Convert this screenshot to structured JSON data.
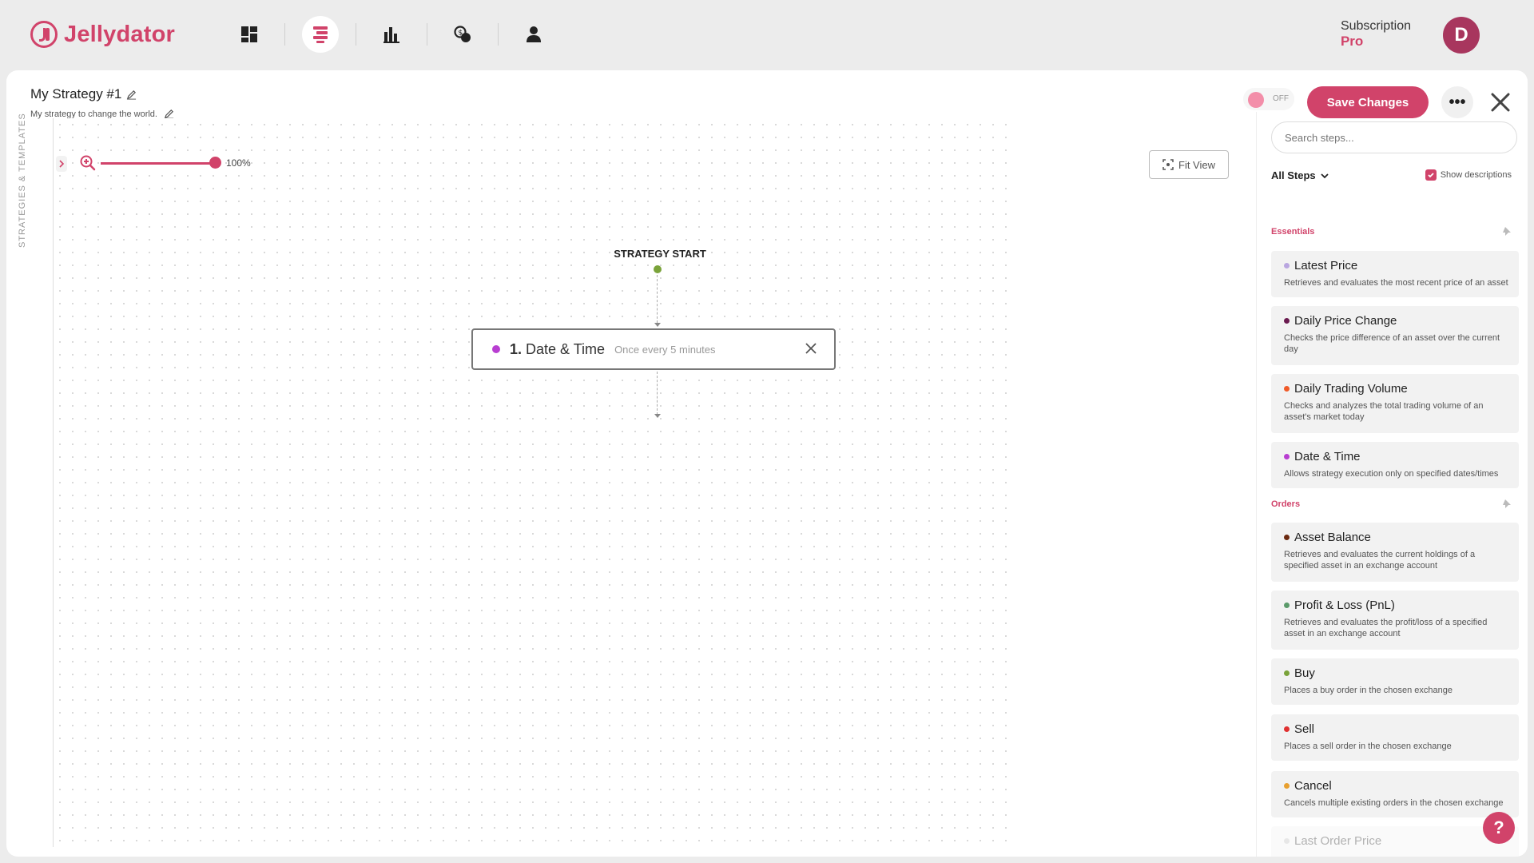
{
  "app": {
    "name": "Jellydator"
  },
  "nav": {
    "items": [
      {
        "name": "dashboard",
        "icon": "dashboard-icon"
      },
      {
        "name": "strategies",
        "icon": "strategy-icon"
      },
      {
        "name": "analytics",
        "icon": "bar-chart-icon"
      },
      {
        "name": "exchanges",
        "icon": "coins-icon"
      },
      {
        "name": "account",
        "icon": "user-icon"
      }
    ],
    "active": "strategies"
  },
  "subscription": {
    "label": "Subscription",
    "plan": "Pro"
  },
  "user": {
    "initial": "D"
  },
  "strategy": {
    "name": "My Strategy #1",
    "description": "My strategy to change the world.",
    "enabled_label": "OFF",
    "save_label": "Save Changes"
  },
  "canvas": {
    "side_tab_label": "STRATEGIES & TEMPLATES",
    "zoom_label": "100%",
    "zoom_percent": 100,
    "fit_view_label": "Fit View",
    "start_label": "STRATEGY START",
    "nodes": [
      {
        "number": "1.",
        "title": "Date & Time",
        "subtitle": "Once every 5 minutes",
        "color": "#b83ed1"
      }
    ]
  },
  "panel": {
    "search_placeholder": "Search steps...",
    "filter_label": "All Steps",
    "show_descriptions_label": "Show descriptions",
    "show_descriptions": true,
    "sections": [
      {
        "label": "Essentials",
        "steps": [
          {
            "title": "Latest Price",
            "description": "Retrieves and evaluates the most recent price of an asset",
            "color": "#b9a6e0"
          },
          {
            "title": "Daily Price Change",
            "description": "Checks the price difference of an asset over the current day",
            "color": "#6a1a4f"
          },
          {
            "title": "Daily Trading Volume",
            "description": "Checks and analyzes the total trading volume of an asset's market today",
            "color": "#f05a28"
          },
          {
            "title": "Date & Time",
            "description": "Allows strategy execution only on specified dates/times",
            "color": "#b83ed1"
          }
        ]
      },
      {
        "label": "Orders",
        "steps": [
          {
            "title": "Asset Balance",
            "description": "Retrieves and evaluates the current holdings of a specified asset in an exchange account",
            "color": "#6b2a10"
          },
          {
            "title": "Profit & Loss (PnL)",
            "description": "Retrieves and evaluates the profit/loss of a specified asset in an exchange account",
            "color": "#5b9a6a"
          },
          {
            "title": "Buy",
            "description": "Places a buy order in the chosen exchange",
            "color": "#7aa33a"
          },
          {
            "title": "Sell",
            "description": "Places a sell order in the chosen exchange",
            "color": "#e03030"
          },
          {
            "title": "Cancel",
            "description": "Cancels multiple existing orders in the chosen exchange",
            "color": "#e8a030"
          },
          {
            "title": "Last Order Price",
            "description": "",
            "color": "#bbbbbb"
          }
        ]
      }
    ]
  },
  "colors": {
    "accent": "#d1436a"
  }
}
